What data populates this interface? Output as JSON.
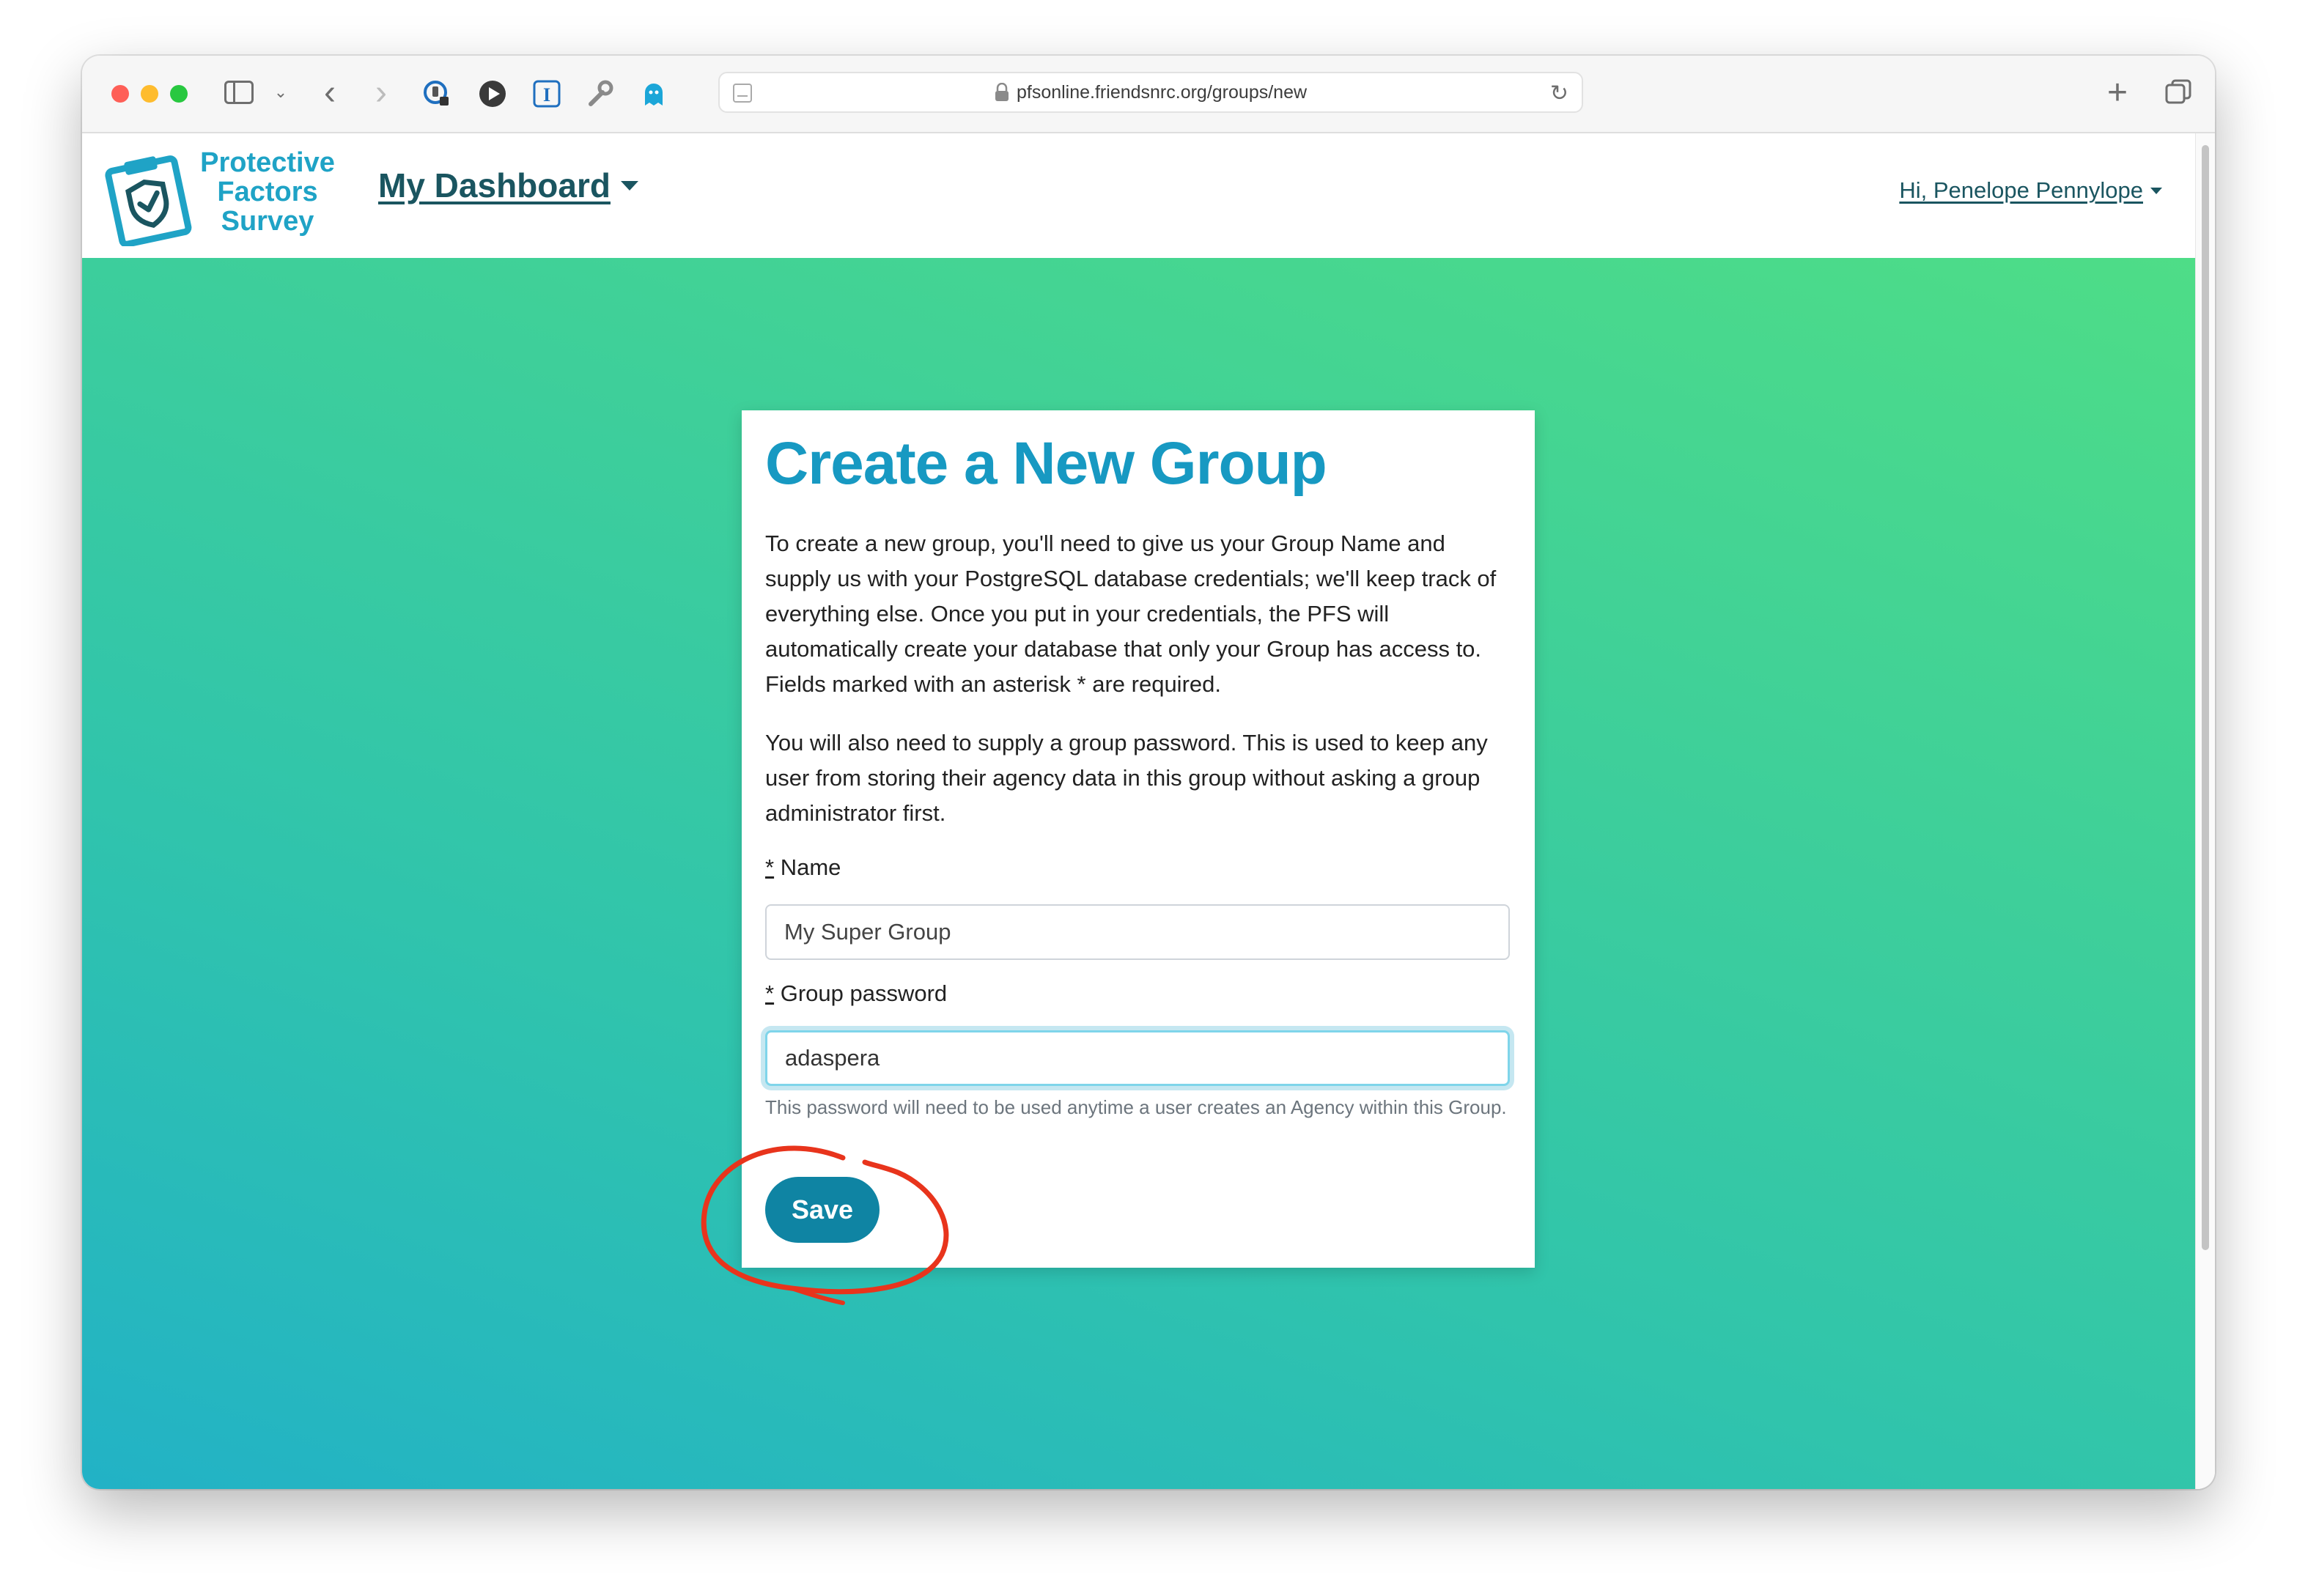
{
  "browser": {
    "url": "pfsonline.friendsnrc.org/groups/new"
  },
  "site": {
    "logo_lines": [
      "Protective",
      "Factors",
      "Survey"
    ],
    "dashboard_label": "My Dashboard",
    "user_label": "Hi, Penelope Pennylope"
  },
  "form": {
    "title": "Create a New Group",
    "intro": "To create a new group, you'll need to give us your Group Name and supply us with your PostgreSQL database credentials; we'll keep track of everything else. Once you put in your credentials, the PFS will automatically create your database that only your Group has access to. Fields marked with an asterisk * are required.",
    "password_note": "You will also need to supply a group password. This is used to keep any user from storing their agency data in this group without asking a group administrator first.",
    "required_marker": "*",
    "name_label": "Name",
    "name_value": "My Super Group",
    "password_label": "Group password",
    "password_value": "adaspera",
    "password_help": "This password will need to be used anytime a user creates an Agency within this Group.",
    "save_label": "Save"
  },
  "colors": {
    "brand": "#1799c2",
    "button": "#0f84a3",
    "annotation": "#e8341c",
    "gradient_top": "#4edd87",
    "gradient_bottom": "#22b2c6"
  }
}
